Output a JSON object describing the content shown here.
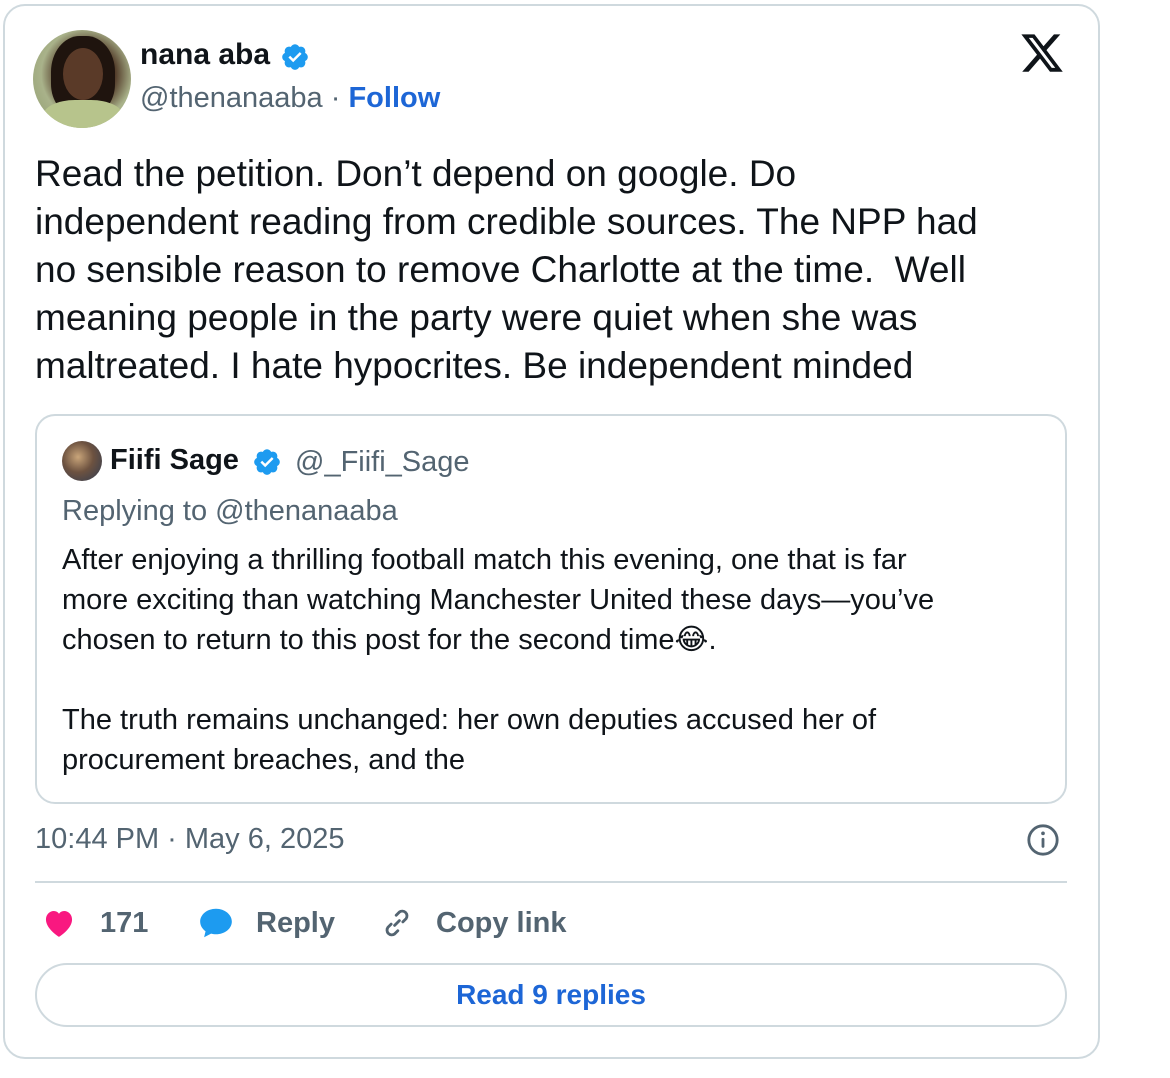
{
  "tweet": {
    "author": {
      "name": "nana aba",
      "handle": "@thenanaaba",
      "separator": "·",
      "follow_label": "Follow",
      "verified": true
    },
    "text": "Read the petition. Don’t depend on google. Do\nindependent reading from credible sources. The NPP had\nno sensible reason to remove Charlotte at the time.  Well\nmeaning people in the party were quiet when she was\nmaltreated. I hate hypocrites. Be independent minded",
    "quoted": {
      "name": "Fiifi Sage",
      "handle": "@_Fiifi_Sage",
      "verified": true,
      "replying_to": "Replying to @thenanaaba",
      "text": "After enjoying a thrilling football match this evening, one that is far\nmore exciting than watching Manchester United these days—you’ve\nchosen to return to this post for the second time😂.\n\nThe truth remains unchanged: her own deputies accused her of\nprocurement breaches, and the"
    },
    "timestamp": "10:44 PM · May 6, 2025",
    "actions": {
      "likes": "171",
      "reply_label": "Reply",
      "copy_link_label": "Copy link"
    },
    "read_replies_label": "Read 9 replies"
  },
  "icons": {
    "brand": "x-logo-icon",
    "like": "heart-icon",
    "reply": "speech-bubble-icon",
    "copy": "link-icon",
    "info": "info-icon",
    "verified": "verified-badge-icon"
  },
  "colors": {
    "like": "#f91880",
    "link": "#1d66d6",
    "reply_icon": "#1d9bf0",
    "verified": "#1d9bf0",
    "muted": "#536471",
    "border": "#cfd9de"
  }
}
